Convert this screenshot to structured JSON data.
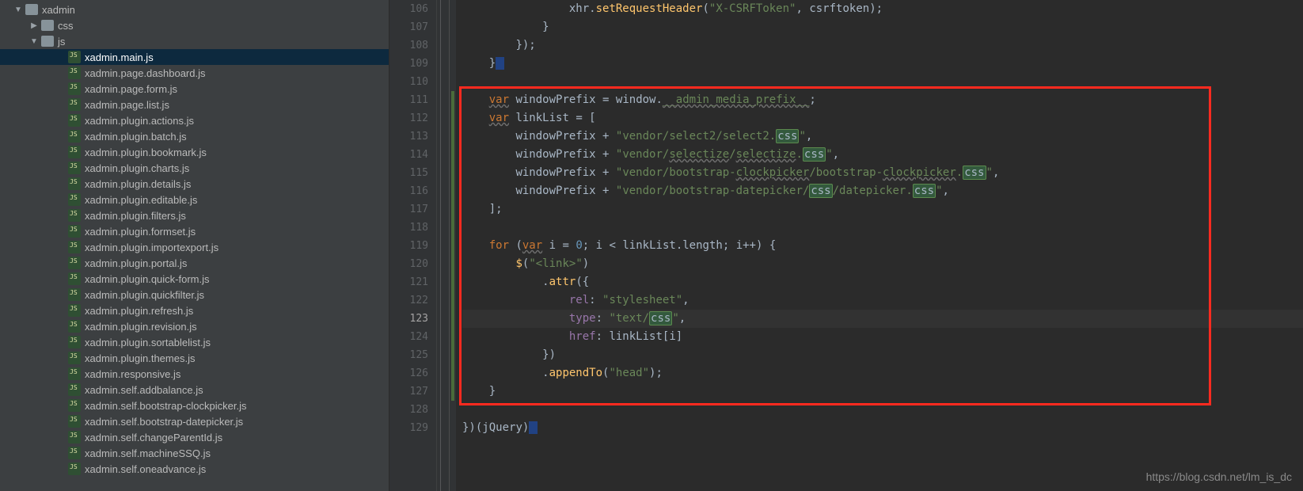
{
  "tree": {
    "root": {
      "label": "xadmin",
      "type": "folder",
      "expanded": true,
      "depth": 0
    },
    "css": {
      "label": "css",
      "type": "folder",
      "expanded": false,
      "depth": 1
    },
    "js": {
      "label": "js",
      "type": "folder",
      "expanded": true,
      "depth": 1
    },
    "files": [
      "xadmin.main.js",
      "xadmin.page.dashboard.js",
      "xadmin.page.form.js",
      "xadmin.page.list.js",
      "xadmin.plugin.actions.js",
      "xadmin.plugin.batch.js",
      "xadmin.plugin.bookmark.js",
      "xadmin.plugin.charts.js",
      "xadmin.plugin.details.js",
      "xadmin.plugin.editable.js",
      "xadmin.plugin.filters.js",
      "xadmin.plugin.formset.js",
      "xadmin.plugin.importexport.js",
      "xadmin.plugin.portal.js",
      "xadmin.plugin.quick-form.js",
      "xadmin.plugin.quickfilter.js",
      "xadmin.plugin.refresh.js",
      "xadmin.plugin.revision.js",
      "xadmin.plugin.sortablelist.js",
      "xadmin.plugin.themes.js",
      "xadmin.responsive.js",
      "xadmin.self.addbalance.js",
      "xadmin.self.bootstrap-clockpicker.js",
      "xadmin.self.bootstrap-datepicker.js",
      "xadmin.self.changeParentId.js",
      "xadmin.self.machineSSQ.js",
      "xadmin.self.oneadvance.js"
    ],
    "selected_index": 0
  },
  "editor": {
    "first_line_number": 106,
    "current_line_number": 123,
    "lines": [
      {
        "n": 106,
        "indent": "                ",
        "tokens": [
          {
            "t": "id",
            "v": "xhr"
          },
          {
            "t": "op",
            "v": "."
          },
          {
            "t": "fn",
            "v": "setRequestHeader"
          },
          {
            "t": "op",
            "v": "("
          },
          {
            "t": "str",
            "v": "\"X-CSRFToken\""
          },
          {
            "t": "op",
            "v": ", "
          },
          {
            "t": "id",
            "v": "csrftoken"
          },
          {
            "t": "op",
            "v": ");"
          }
        ]
      },
      {
        "n": 107,
        "indent": "            ",
        "tokens": [
          {
            "t": "op",
            "v": "}"
          }
        ]
      },
      {
        "n": 108,
        "indent": "        ",
        "tokens": [
          {
            "t": "op",
            "v": "});"
          }
        ]
      },
      {
        "n": 109,
        "indent": "    ",
        "tokens": [
          {
            "t": "op",
            "v": "}"
          },
          {
            "t": "hl2",
            "v": " "
          }
        ]
      },
      {
        "n": 110,
        "indent": "",
        "tokens": []
      },
      {
        "n": 111,
        "indent": "    ",
        "tokens": [
          {
            "t": "kwu",
            "v": "var"
          },
          {
            "t": "op",
            "v": " "
          },
          {
            "t": "id",
            "v": "windowPrefix"
          },
          {
            "t": "op",
            "v": " = "
          },
          {
            "t": "id",
            "v": "window"
          },
          {
            "t": "op",
            "v": "."
          },
          {
            "t": "wavy",
            "v": "__admin_media_prefix__"
          },
          {
            "t": "op",
            "v": ";"
          }
        ]
      },
      {
        "n": 112,
        "indent": "    ",
        "tokens": [
          {
            "t": "kwu",
            "v": "var"
          },
          {
            "t": "op",
            "v": " "
          },
          {
            "t": "id",
            "v": "linkList"
          },
          {
            "t": "op",
            "v": " = ["
          }
        ]
      },
      {
        "n": 113,
        "indent": "        ",
        "tokens": [
          {
            "t": "id",
            "v": "windowPrefix"
          },
          {
            "t": "op",
            "v": " + "
          },
          {
            "t": "str",
            "v": "\"vendor/select2/select2."
          },
          {
            "t": "hl",
            "v": "css"
          },
          {
            "t": "str",
            "v": "\""
          },
          {
            "t": "op",
            "v": ","
          }
        ]
      },
      {
        "n": 114,
        "indent": "        ",
        "tokens": [
          {
            "t": "id",
            "v": "windowPrefix"
          },
          {
            "t": "op",
            "v": " + "
          },
          {
            "t": "str",
            "v": "\"vendor/"
          },
          {
            "t": "wavy",
            "v": "selectize"
          },
          {
            "t": "str",
            "v": "/"
          },
          {
            "t": "wavy",
            "v": "selectize"
          },
          {
            "t": "str",
            "v": "."
          },
          {
            "t": "hl",
            "v": "css"
          },
          {
            "t": "str",
            "v": "\""
          },
          {
            "t": "op",
            "v": ","
          }
        ]
      },
      {
        "n": 115,
        "indent": "        ",
        "tokens": [
          {
            "t": "id",
            "v": "windowPrefix"
          },
          {
            "t": "op",
            "v": " + "
          },
          {
            "t": "str",
            "v": "\"vendor/bootstrap-"
          },
          {
            "t": "wavy",
            "v": "clockpicker"
          },
          {
            "t": "str",
            "v": "/bootstrap-"
          },
          {
            "t": "wavy",
            "v": "clockpicker"
          },
          {
            "t": "str",
            "v": "."
          },
          {
            "t": "hl",
            "v": "css"
          },
          {
            "t": "str",
            "v": "\""
          },
          {
            "t": "op",
            "v": ","
          }
        ]
      },
      {
        "n": 116,
        "indent": "        ",
        "tokens": [
          {
            "t": "id",
            "v": "windowPrefix"
          },
          {
            "t": "op",
            "v": " + "
          },
          {
            "t": "str",
            "v": "\"vendor/bootstrap-datepicker/"
          },
          {
            "t": "hl",
            "v": "css"
          },
          {
            "t": "str",
            "v": "/datepicker."
          },
          {
            "t": "hl",
            "v": "css"
          },
          {
            "t": "str",
            "v": "\""
          },
          {
            "t": "op",
            "v": ","
          }
        ]
      },
      {
        "n": 117,
        "indent": "    ",
        "tokens": [
          {
            "t": "op",
            "v": "];"
          }
        ]
      },
      {
        "n": 118,
        "indent": "",
        "tokens": []
      },
      {
        "n": 119,
        "indent": "    ",
        "tokens": [
          {
            "t": "kw",
            "v": "for"
          },
          {
            "t": "op",
            "v": " ("
          },
          {
            "t": "kwu",
            "v": "var"
          },
          {
            "t": "op",
            "v": " "
          },
          {
            "t": "id",
            "v": "i"
          },
          {
            "t": "op",
            "v": " = "
          },
          {
            "t": "num",
            "v": "0"
          },
          {
            "t": "op",
            "v": "; "
          },
          {
            "t": "id",
            "v": "i"
          },
          {
            "t": "op",
            "v": " < "
          },
          {
            "t": "id",
            "v": "linkList"
          },
          {
            "t": "op",
            "v": "."
          },
          {
            "t": "id",
            "v": "length"
          },
          {
            "t": "op",
            "v": "; "
          },
          {
            "t": "id",
            "v": "i"
          },
          {
            "t": "op",
            "v": "++) {"
          }
        ]
      },
      {
        "n": 120,
        "indent": "        ",
        "tokens": [
          {
            "t": "fn",
            "v": "$"
          },
          {
            "t": "op",
            "v": "("
          },
          {
            "t": "str",
            "v": "\"<link>\""
          },
          {
            "t": "op",
            "v": ")"
          }
        ]
      },
      {
        "n": 121,
        "indent": "            ",
        "tokens": [
          {
            "t": "op",
            "v": "."
          },
          {
            "t": "fn",
            "v": "attr"
          },
          {
            "t": "op",
            "v": "({"
          }
        ]
      },
      {
        "n": 122,
        "indent": "                ",
        "tokens": [
          {
            "t": "prop",
            "v": "rel"
          },
          {
            "t": "op",
            "v": ": "
          },
          {
            "t": "str",
            "v": "\"stylesheet\""
          },
          {
            "t": "op",
            "v": ","
          }
        ]
      },
      {
        "n": 123,
        "indent": "                ",
        "cur": true,
        "tokens": [
          {
            "t": "prop",
            "v": "type"
          },
          {
            "t": "op",
            "v": ": "
          },
          {
            "t": "str",
            "v": "\"text/"
          },
          {
            "t": "hl",
            "v": "css"
          },
          {
            "t": "str",
            "v": "\""
          },
          {
            "t": "op",
            "v": ","
          }
        ]
      },
      {
        "n": 124,
        "indent": "                ",
        "tokens": [
          {
            "t": "prop",
            "v": "href"
          },
          {
            "t": "op",
            "v": ": "
          },
          {
            "t": "id",
            "v": "linkList"
          },
          {
            "t": "op",
            "v": "["
          },
          {
            "t": "id",
            "v": "i"
          },
          {
            "t": "op",
            "v": "]"
          }
        ]
      },
      {
        "n": 125,
        "indent": "            ",
        "tokens": [
          {
            "t": "op",
            "v": "})"
          }
        ]
      },
      {
        "n": 126,
        "indent": "            ",
        "tokens": [
          {
            "t": "op",
            "v": "."
          },
          {
            "t": "fn",
            "v": "appendTo"
          },
          {
            "t": "op",
            "v": "("
          },
          {
            "t": "str",
            "v": "\"head\""
          },
          {
            "t": "op",
            "v": ");"
          }
        ]
      },
      {
        "n": 127,
        "indent": "    ",
        "tokens": [
          {
            "t": "op",
            "v": "}"
          }
        ]
      },
      {
        "n": 128,
        "indent": "",
        "tokens": []
      },
      {
        "n": 129,
        "indent": "",
        "tokens": [
          {
            "t": "op",
            "v": "})("
          },
          {
            "t": "id",
            "v": "jQuery"
          },
          {
            "t": "op",
            "v": ")"
          },
          {
            "t": "hl2",
            "v": " "
          }
        ]
      }
    ],
    "red_box": {
      "from_line": 111,
      "to_line": 127
    },
    "change_markers_visible": true
  },
  "watermark": "https://blog.csdn.net/lm_is_dc"
}
